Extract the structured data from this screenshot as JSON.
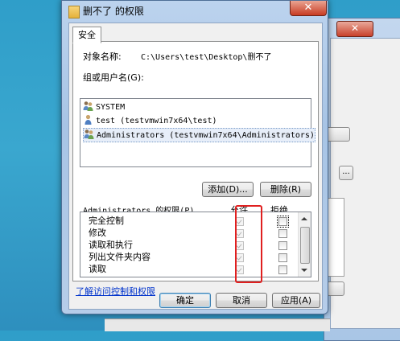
{
  "dialog": {
    "title": "删不了 的权限",
    "close_glyph": "✕",
    "tab_label": "安全",
    "object_name_label": "对象名称:",
    "object_name_value": "C:\\Users\\test\\Desktop\\删不了",
    "groups_label": "组或用户名(G):",
    "principals": [
      {
        "name": "SYSTEM",
        "icon": "users-group-icon"
      },
      {
        "name": "test (testvmwin7x64\\test)",
        "icon": "user-icon"
      },
      {
        "name": "Administrators (testvmwin7x64\\Administrators)",
        "icon": "users-group-icon"
      }
    ],
    "add_button": "添加(D)...",
    "remove_button": "删除(R)",
    "permissions_label": "Administrators 的权限(P)",
    "allow_header": "允许",
    "deny_header": "拒绝",
    "permissions": [
      {
        "name": "完全控制",
        "allow": true,
        "deny": false
      },
      {
        "name": "修改",
        "allow": true,
        "deny": false
      },
      {
        "name": "读取和执行",
        "allow": true,
        "deny": false
      },
      {
        "name": "列出文件夹内容",
        "allow": true,
        "deny": false
      },
      {
        "name": "读取",
        "allow": true,
        "deny": false
      }
    ],
    "link_text": "了解访问控制和权限",
    "ok_button": "确定",
    "cancel_button": "取消",
    "apply_button": "应用(A)"
  },
  "background_window": {
    "close_glyph": "✕",
    "button_fragment": "..."
  },
  "colors": {
    "highlight_outline": "#e02020",
    "link": "#0033cc"
  }
}
